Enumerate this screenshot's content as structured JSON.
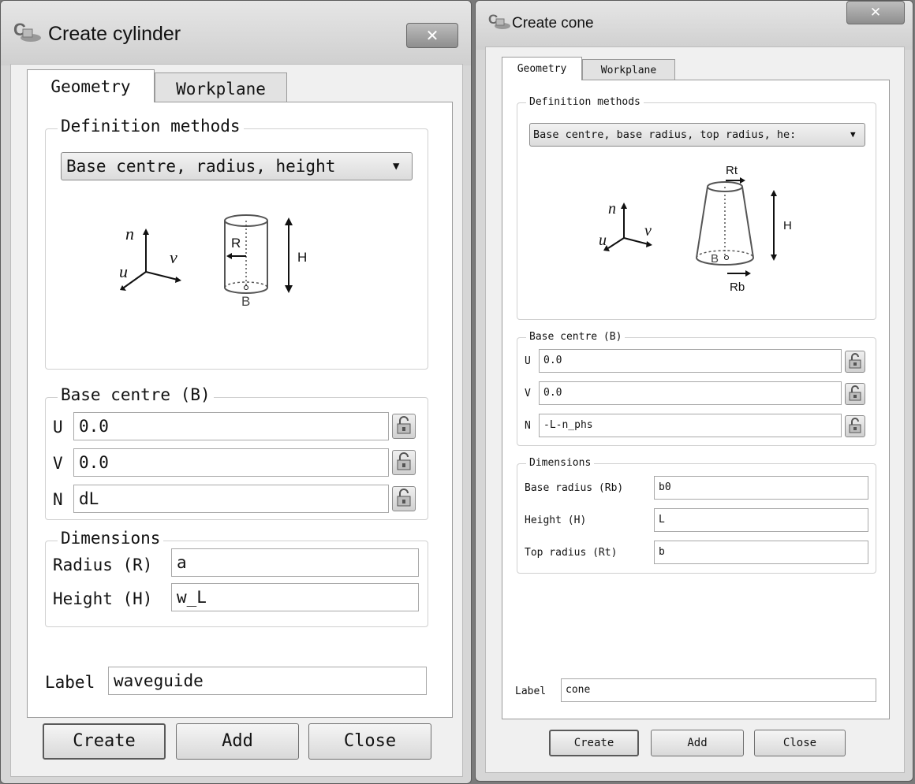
{
  "cylinder_dialog": {
    "title": "Create cylinder",
    "close_glyph": "✕",
    "tabs": [
      "Geometry",
      "Workplane"
    ],
    "definition_methods": {
      "title": "Definition methods",
      "selected": "Base centre, radius, height",
      "diagram": {
        "axis_n": "n",
        "axis_u": "u",
        "axis_v": "v",
        "radius": "R",
        "height": "H",
        "base": "B"
      }
    },
    "base_centre": {
      "title": "Base centre (B)",
      "fields": [
        {
          "label": "U",
          "value": "0.0"
        },
        {
          "label": "V",
          "value": "0.0"
        },
        {
          "label": "N",
          "value": "dL"
        }
      ]
    },
    "dimensions": {
      "title": "Dimensions",
      "fields": [
        {
          "label": "Radius (R)",
          "value": "a"
        },
        {
          "label": "Height (H)",
          "value": "w_L"
        }
      ]
    },
    "label": {
      "label": "Label",
      "value": "waveguide"
    },
    "buttons": {
      "create": "Create",
      "add": "Add",
      "close": "Close"
    }
  },
  "cone_dialog": {
    "title": "Create cone",
    "close_glyph": "✕",
    "tabs": [
      "Geometry",
      "Workplane"
    ],
    "definition_methods": {
      "title": "Definition methods",
      "selected": "Base centre, base radius, top radius, he:",
      "diagram": {
        "axis_n": "n",
        "axis_u": "u",
        "axis_v": "v",
        "top_radius": "Rt",
        "base_radius": "Rb",
        "height": "H",
        "base": "B"
      }
    },
    "base_centre": {
      "title": "Base centre (B)",
      "fields": [
        {
          "label": "U",
          "value": "0.0"
        },
        {
          "label": "V",
          "value": "0.0"
        },
        {
          "label": "N",
          "value": "-L-n_phs"
        }
      ]
    },
    "dimensions": {
      "title": "Dimensions",
      "fields": [
        {
          "label": "Base radius (Rb)",
          "value": "b0"
        },
        {
          "label": "Height (H)",
          "value": "L"
        },
        {
          "label": "Top radius (Rt)",
          "value": "b"
        }
      ]
    },
    "label": {
      "label": "Label",
      "value": "cone"
    },
    "buttons": {
      "create": "Create",
      "add": "Add",
      "close": "Close"
    }
  }
}
